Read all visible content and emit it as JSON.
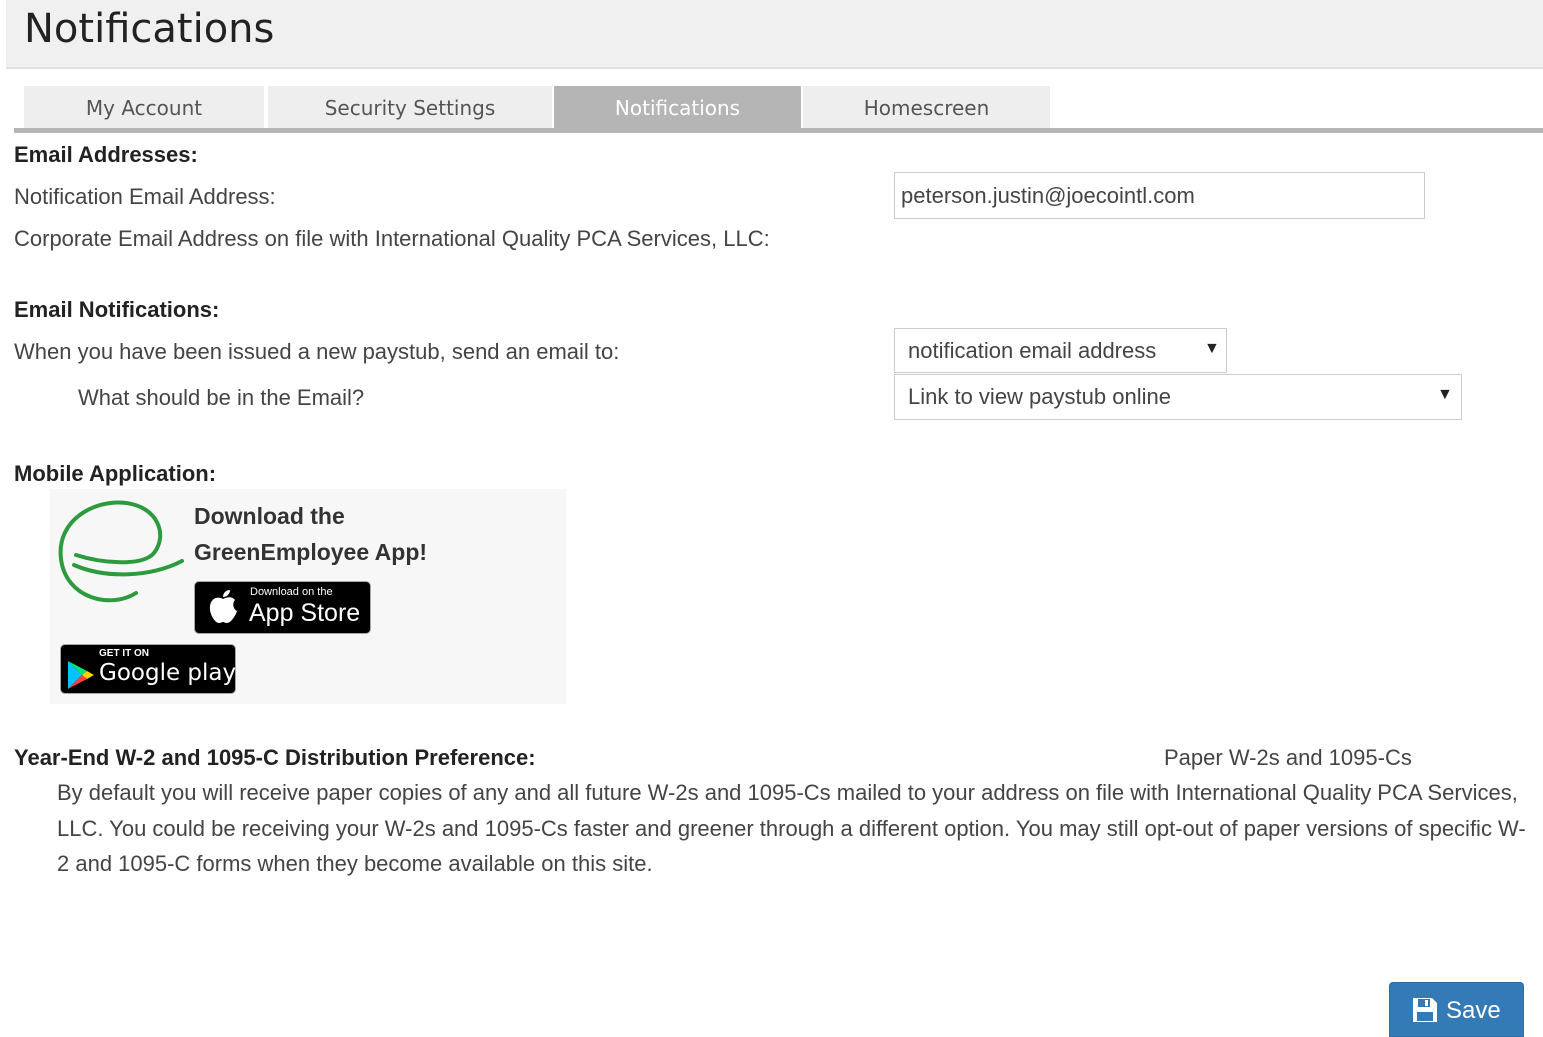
{
  "page": {
    "title": "Notifications",
    "tabs": [
      {
        "label": "My Account",
        "active": false
      },
      {
        "label": "Security Settings",
        "active": false
      },
      {
        "label": "Notifications",
        "active": true
      },
      {
        "label": "Homescreen",
        "active": false
      }
    ]
  },
  "email_addresses": {
    "heading": "Email Addresses:",
    "notification_label": "Notification Email Address:",
    "notification_value": "peterson.justin@joecointl.com",
    "corporate_label": "Corporate Email Address on file with International Quality PCA Services, LLC:"
  },
  "email_notifications": {
    "heading": "Email Notifications:",
    "paystub_label": "When you have been issued a new paystub, send an email to:",
    "paystub_selected": "notification email address",
    "content_label": "What should be in the Email?",
    "content_selected": "Link to view paystub online"
  },
  "mobile_app": {
    "heading": "Mobile Application:",
    "line1": "Download the",
    "line2": "GreenEmployee App!",
    "app_store_small": "Download on the",
    "app_store_big": "App Store",
    "google_play_small": "GET IT ON",
    "google_play_big": "Google play",
    "logo_color": "#2e9a3e"
  },
  "year_end": {
    "heading": "Year-End W-2 and 1095-C Distribution Preference:",
    "current_value": "Paper W-2s and 1095-Cs",
    "description": "By default you will receive paper copies of any and all future W-2s and 1095-Cs mailed to your address on file with International Quality PCA Services, LLC. You could be receiving your W-2s and 1095-Cs faster and greener through a different option. You may still opt-out of paper versions of specific W-2 and 1095-C forms when they become available on this site."
  },
  "actions": {
    "save_label": "Save",
    "save_color": "#337ab7"
  }
}
